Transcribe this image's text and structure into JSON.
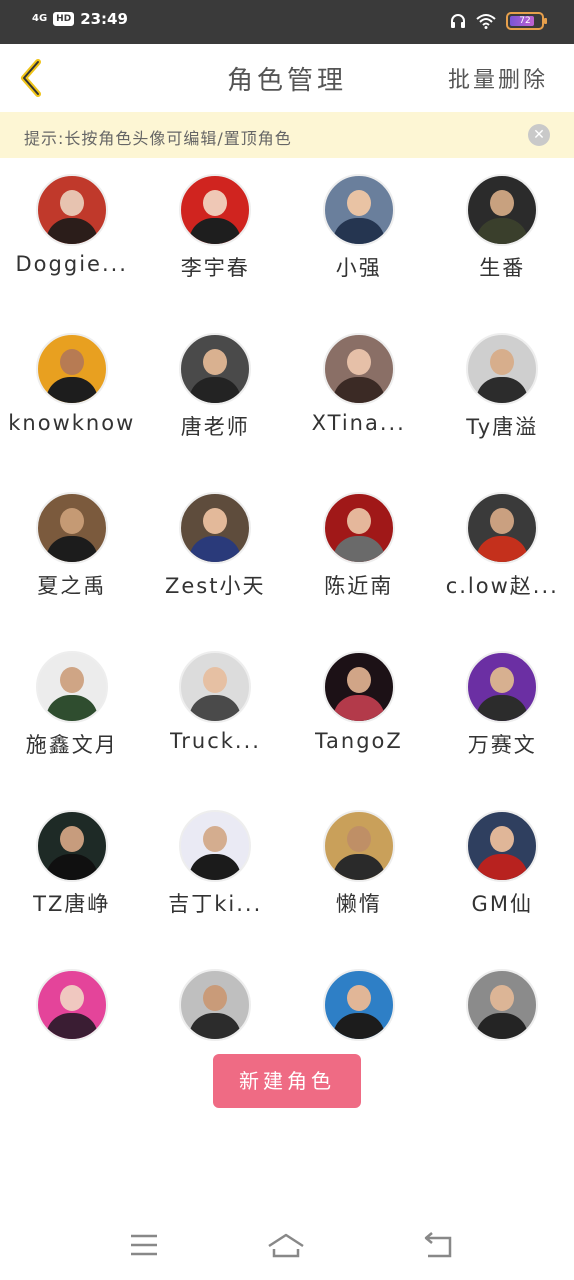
{
  "status_bar": {
    "network": "4G",
    "hd": "HD",
    "time": "23:49",
    "battery": "72"
  },
  "header": {
    "title": "角色管理",
    "batch_delete": "批量删除"
  },
  "tip": {
    "text": "提示:长按角色头像可编辑/置顶角色"
  },
  "roles": [
    {
      "name": "Doggie...",
      "colors": [
        "#c0392b",
        "#2b1d1a",
        "#e7c3b0"
      ]
    },
    {
      "name": "李宇春",
      "colors": [
        "#d0241f",
        "#1e1e1e",
        "#efc8b6"
      ]
    },
    {
      "name": "小强",
      "colors": [
        "#6a7f9c",
        "#253550",
        "#e9c3a4"
      ]
    },
    {
      "name": "生番",
      "colors": [
        "#2b2b2b",
        "#3a3f2c",
        "#c8a17f"
      ]
    },
    {
      "name": "knowknow",
      "colors": [
        "#e8a020",
        "#1d1d1d",
        "#b77b53"
      ]
    },
    {
      "name": "唐老师",
      "colors": [
        "#4a4a4a",
        "#232323",
        "#d9b190"
      ]
    },
    {
      "name": "XTina...",
      "colors": [
        "#8a6f66",
        "#3b2a25",
        "#e6c0a8"
      ]
    },
    {
      "name": "Ty唐溢",
      "colors": [
        "#cfcfcf",
        "#2c2c2c",
        "#d7ae8c"
      ]
    },
    {
      "name": "夏之禹",
      "colors": [
        "#7b5a3d",
        "#1c1c1c",
        "#c59a74"
      ]
    },
    {
      "name": "Zest小天",
      "colors": [
        "#5e4c3c",
        "#2a3a7a",
        "#e3b99a"
      ]
    },
    {
      "name": "陈近南",
      "colors": [
        "#a01818",
        "#6a6a6a",
        "#e5b79b"
      ]
    },
    {
      "name": "c.low赵...",
      "colors": [
        "#3a3a3a",
        "#c4301c",
        "#caa080"
      ]
    },
    {
      "name": "施鑫文月",
      "colors": [
        "#ececec",
        "#2f4d2f",
        "#cfa585"
      ]
    },
    {
      "name": "Truck...",
      "colors": [
        "#dcdcdc",
        "#4a4a4a",
        "#e6c0a3"
      ]
    },
    {
      "name": "TangoZ",
      "colors": [
        "#1c1116",
        "#b33a4a",
        "#d1a587"
      ]
    },
    {
      "name": "万赛文",
      "colors": [
        "#6b2fa3",
        "#2c2c2c",
        "#d7b090"
      ]
    },
    {
      "name": "TZ唐峥",
      "colors": [
        "#1e2a26",
        "#101010",
        "#c79c7d"
      ]
    },
    {
      "name": "吉丁ki...",
      "colors": [
        "#eaeaf4",
        "#1b1b1b",
        "#d4ad8f"
      ]
    },
    {
      "name": "懒惰",
      "colors": [
        "#c9a05a",
        "#2a2a2a",
        "#bf8f66"
      ]
    },
    {
      "name": "GM仙",
      "colors": [
        "#2f3f5f",
        "#b8221f",
        "#e0b698"
      ]
    },
    {
      "name": "",
      "colors": [
        "#e4449a",
        "#3a1d33",
        "#f0c8c0"
      ]
    },
    {
      "name": "",
      "colors": [
        "#bfbfbf",
        "#2c2c2c",
        "#c99b79"
      ]
    },
    {
      "name": "",
      "colors": [
        "#2e7fc6",
        "#1c1c1c",
        "#e1b697"
      ]
    },
    {
      "name": "",
      "colors": [
        "#8b8b8b",
        "#242424",
        "#dcb596"
      ]
    }
  ],
  "new_role_button": "新建角色",
  "nav": {
    "menu_icon": "menu-icon",
    "home_icon": "home-icon",
    "back_icon": "back-icon"
  }
}
